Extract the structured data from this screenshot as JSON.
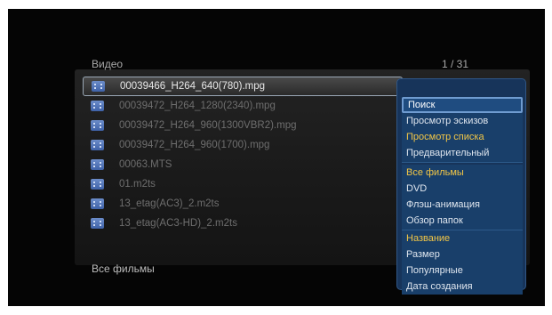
{
  "header": {
    "title": "Видео",
    "page_indicator": "1 / 31"
  },
  "files": [
    {
      "name": "00039466_H264_640(780).mpg",
      "selected": true
    },
    {
      "name": "00039472_H264_1280(2340).mpg"
    },
    {
      "name": "00039472_H264_960(1300VBR2).mpg"
    },
    {
      "name": "00039472_H264_960(1700).mpg"
    },
    {
      "name": "00063.MTS"
    },
    {
      "name": "01.m2ts"
    },
    {
      "name": "13_etag(AC3)_2.m2ts"
    },
    {
      "name": "13_etag(AC3-HD)_2.m2ts"
    }
  ],
  "footer": {
    "filter_label": "Все фильмы"
  },
  "menu": {
    "search": "Поиск",
    "thumbnails": "Просмотр эскизов",
    "list_view": "Просмотр списка",
    "preview": "Предварительный",
    "all_movies": "Все фильмы",
    "dvd": "DVD",
    "flash": "Флэш-анимация",
    "browse_folders": "Обзор папок",
    "sort_name": "Название",
    "sort_size": "Размер",
    "sort_popular": "Популярные",
    "sort_date": "Дата создания"
  },
  "colors": {
    "background": "#050505",
    "panel": "#1e1e1e",
    "menu": "#17345a",
    "highlight": "#f2c646",
    "text_dim": "#6e6e6e"
  },
  "icons": {
    "file": "video-file-icon"
  }
}
